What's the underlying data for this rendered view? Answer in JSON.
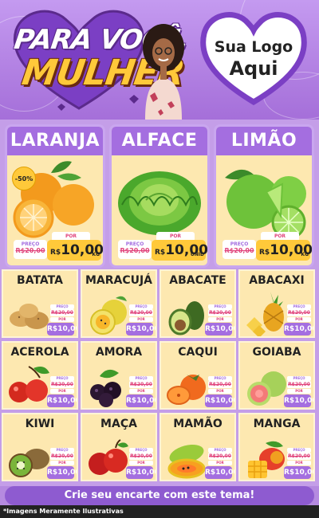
{
  "header": {
    "title_line1": "PARA VOCÊ,",
    "title_line2": "MULHER",
    "logo_line1": "Sua Logo",
    "logo_line2": "Aqui"
  },
  "colors": {
    "purple": "#a46ee0",
    "lilac": "#c49ee8",
    "yellow": "#ffc93a",
    "cream": "#fde8b0",
    "pink": "#e0437b"
  },
  "featured": [
    {
      "name": "LARANJA",
      "old_label": "PREÇO",
      "old_price": "R$20,00",
      "new_label": "POR",
      "currency": "R$",
      "price": "10,00",
      "unit": "KG",
      "discount": "-50%",
      "icon": "orange-icon"
    },
    {
      "name": "ALFACE",
      "old_label": "PREÇO",
      "old_price": "R$20,00",
      "new_label": "POR",
      "currency": "R$",
      "price": "10,00",
      "unit": "UNID",
      "icon": "lettuce-icon"
    },
    {
      "name": "LIMÃO",
      "old_label": "PREÇO",
      "old_price": "R$20,00",
      "new_label": "POR",
      "currency": "R$",
      "price": "10,00",
      "unit": "KG",
      "icon": "lime-icon"
    }
  ],
  "products": [
    {
      "name": "BATATA",
      "icon": "potato-icon"
    },
    {
      "name": "MARACUJÁ",
      "icon": "passion-fruit-icon"
    },
    {
      "name": "ABACATE",
      "icon": "avocado-icon"
    },
    {
      "name": "ABACAXI",
      "icon": "pineapple-icon"
    },
    {
      "name": "ACEROLA",
      "icon": "acerola-icon"
    },
    {
      "name": "AMORA",
      "icon": "blackberry-icon"
    },
    {
      "name": "CAQUI",
      "icon": "persimmon-icon"
    },
    {
      "name": "GOIABA",
      "icon": "guava-icon"
    },
    {
      "name": "KIWI",
      "icon": "kiwi-icon"
    },
    {
      "name": "MAÇA",
      "icon": "apple-icon"
    },
    {
      "name": "MAMÃO",
      "icon": "papaya-icon"
    },
    {
      "name": "MANGA",
      "icon": "mango-icon"
    }
  ],
  "small_price": {
    "old_label": "PREÇO",
    "old_price": "R$20,00",
    "new_label": "POR",
    "price": "R$10,00"
  },
  "cta": "Crie seu encarte com este tema!",
  "disclaimer": "*Imagens Meramente Ilustrativas"
}
